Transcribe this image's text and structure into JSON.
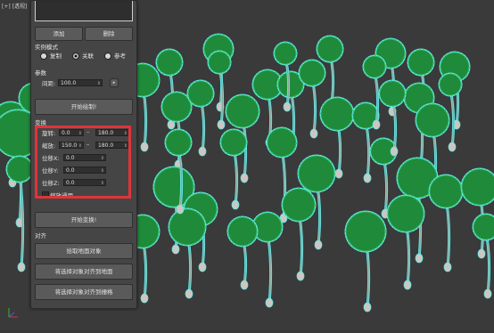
{
  "viewport": {
    "label": "[+] [透视]"
  },
  "panel": {
    "add_label": "添加",
    "delete_label": "删除",
    "instance_mode": {
      "title": "实例模式",
      "options": [
        "复制",
        "关联",
        "参考"
      ],
      "selected": "关联"
    },
    "params": {
      "title": "参数",
      "spacing_label": "间距:",
      "spacing_value": "100.0",
      "start_paint_label": "开始绘制!"
    },
    "transform": {
      "title": "变换",
      "rotate_label": "旋转:",
      "rotate_min": "0.0",
      "rotate_max": "180.0",
      "scale_label": "缩放:",
      "scale_min": "150.0",
      "scale_max": "180.0",
      "offset_x_label": "位移X:",
      "offset_x_value": "0.0",
      "offset_y_label": "位移Y:",
      "offset_y_value": "0.0",
      "offset_z_label": "位移Z:",
      "offset_z_value": "0.0",
      "uniform_scale_label": "缩放通用",
      "start_transform_label": "开始变换!"
    },
    "align": {
      "title": "对齐",
      "pick_ground_label": "拾取地面对象",
      "align_to_ground_label": "将选择对象对齐到地面",
      "align_to_grid_label": "将选择对象对齐到栅格"
    }
  },
  "colors": {
    "highlight": "#e0343a",
    "outline": "#5fe8e8",
    "foliage": "#1f8a3a"
  }
}
